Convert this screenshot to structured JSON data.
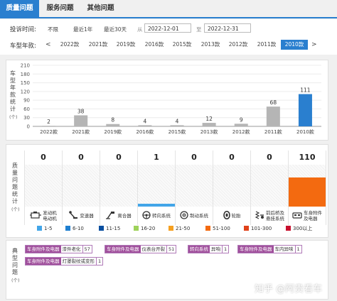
{
  "tabs": [
    {
      "label": "质量问题",
      "active": true
    },
    {
      "label": "服务问题",
      "active": false
    },
    {
      "label": "其他问题",
      "active": false
    }
  ],
  "filter": {
    "time_label": "投诉时间:",
    "time_options": [
      "不限",
      "最近1年",
      "最近30天"
    ],
    "from_label": "从",
    "from_value": "2022-12-01",
    "to_label": "至",
    "to_value": "2022-12-31",
    "model_year_label": "车型年款:",
    "prev_arrow": "<",
    "next_arrow": ">",
    "years": [
      "2022款",
      "2021款",
      "2019款",
      "2016款",
      "2015款",
      "2013款",
      "2012款",
      "2011款",
      "2010款"
    ],
    "selected_year": "2010款"
  },
  "year_stats": {
    "vertical_label": [
      "车",
      "型",
      "年",
      "款",
      "统",
      "计"
    ],
    "unit": "(个)"
  },
  "chart_data": {
    "type": "bar",
    "categories": [
      "2022款",
      "2021款",
      "2019款",
      "2016款",
      "2015款",
      "2013款",
      "2012款",
      "2011款",
      "2010款"
    ],
    "values": [
      2,
      38,
      8,
      4,
      4,
      12,
      9,
      68,
      111
    ],
    "yticks": [
      0,
      30,
      60,
      90,
      120,
      150,
      180,
      210
    ],
    "ylim": [
      0,
      210
    ],
    "highlight_category": "2010款",
    "colors": {
      "default": "#b5b5b5",
      "highlight": "#2a7fcf"
    }
  },
  "quality": {
    "vertical_label": [
      "质",
      "量",
      "问",
      "题",
      "统",
      "计"
    ],
    "unit": "(个)",
    "categories": [
      {
        "name": "发动机\n电动机",
        "icon": "engine-icon",
        "count": "0",
        "level": 0
      },
      {
        "name": "变速器",
        "icon": "gearshift-icon",
        "count": "0",
        "level": 0
      },
      {
        "name": "离合器",
        "icon": "clutch-pedal-icon",
        "count": "0",
        "level": 0
      },
      {
        "name": "转向系统",
        "icon": "steering-wheel-icon",
        "count": "1",
        "level": 0.06
      },
      {
        "name": "制动系统",
        "icon": "brake-disc-icon",
        "count": "0",
        "level": 0
      },
      {
        "name": "轮胎",
        "icon": "tire-icon",
        "count": "0",
        "level": 0
      },
      {
        "name": "前后桥及\n悬挂系统",
        "icon": "suspension-icon",
        "count": "0",
        "level": 0
      },
      {
        "name": "车身附件\n及电器",
        "icon": "car-body-icon",
        "count": "110",
        "level": 0.7
      }
    ],
    "bar_colors": {
      "low": "#42a5e8",
      "high": "#f36a10"
    }
  },
  "legend": [
    {
      "label": "1-5",
      "color": "#42a5e8"
    },
    {
      "label": "6-10",
      "color": "#1f7fd0"
    },
    {
      "label": "11-15",
      "color": "#0a4fa0"
    },
    {
      "label": "16-20",
      "color": "#9ed25a"
    },
    {
      "label": "21-50",
      "color": "#f5a020"
    },
    {
      "label": "51-100",
      "color": "#f36a10"
    },
    {
      "label": "101-300",
      "color": "#e0421a"
    },
    {
      "label": "300以上",
      "color": "#c8102e"
    }
  ],
  "typical": {
    "vertical_label": [
      "典",
      "型",
      "问",
      "题"
    ],
    "unit": "(个)",
    "tags": [
      {
        "category": "车身附件及电器",
        "issue": "漆件老化",
        "count": "57"
      },
      {
        "category": "车身附件及电器",
        "issue": "仪表台开裂",
        "count": "51"
      },
      {
        "category": "转向系统",
        "issue": "异响",
        "count": "1"
      },
      {
        "category": "车身附件及电器",
        "issue": "车内异味",
        "count": "1"
      },
      {
        "category": "车身附件及电器",
        "issue": "灯罩裂纹或变形",
        "count": "1"
      }
    ]
  },
  "watermark": "知乎 @阿贵看车"
}
